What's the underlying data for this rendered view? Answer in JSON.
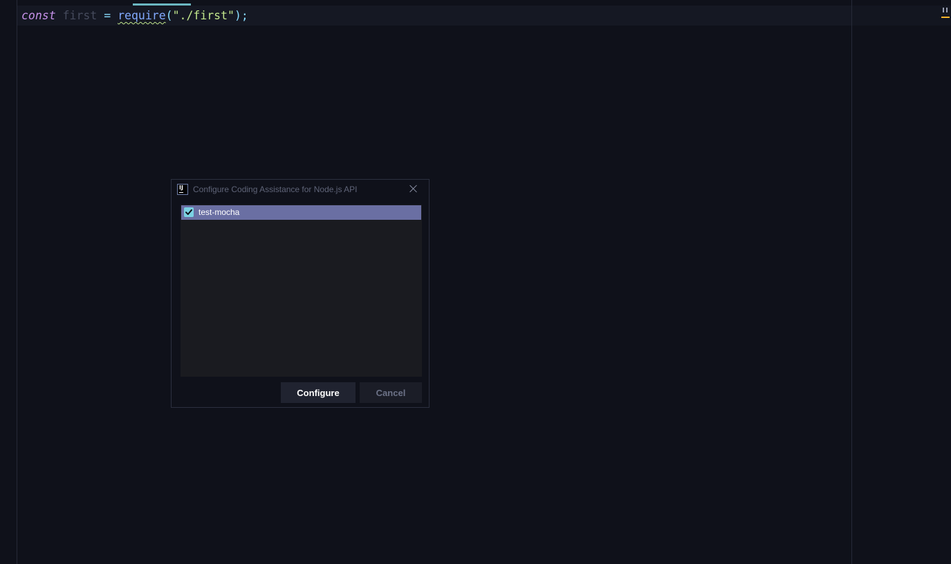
{
  "editor": {
    "code_line": {
      "keyword": "const",
      "identifier": "first",
      "operator": "=",
      "function": "require",
      "open_paren": "(",
      "string": "\"./first\"",
      "close": ");"
    }
  },
  "dialog": {
    "title": "Configure Coding Assistance for Node.js API",
    "app_icon": "IJ",
    "close_icon": "close-icon",
    "list": [
      {
        "label": "test-mocha",
        "checked": true,
        "selected": true
      }
    ],
    "buttons": {
      "configure": "Configure",
      "cancel": "Cancel"
    }
  },
  "colors": {
    "background": "#0f111a",
    "keyword": "#c792ea",
    "function": "#82aaff",
    "string": "#c3e88d",
    "selection": "#6a6fa3",
    "checkbox": "#7bd2e3"
  }
}
